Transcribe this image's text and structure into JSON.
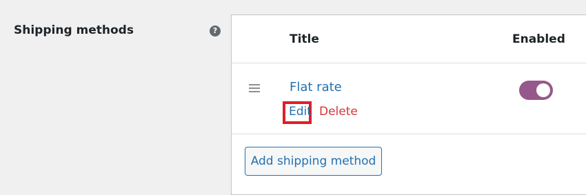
{
  "settings": {
    "label": "Shipping methods",
    "help_icon": "?"
  },
  "table": {
    "columns": {
      "title": "Title",
      "enabled": "Enabled"
    },
    "rows": [
      {
        "title": "Flat rate",
        "edit_label": "Edit",
        "delete_label": "Delete",
        "enabled": true,
        "toggle_color": "#96588a"
      }
    ]
  },
  "actions": {
    "add_label": "Add shipping method"
  },
  "colors": {
    "link": "#2271b1",
    "delete": "#d63638",
    "highlight_box": "#e11d2a",
    "toggle_on": "#96588a"
  },
  "icons": {
    "help": "help-circle-icon",
    "drag": "drag-handle-icon"
  }
}
